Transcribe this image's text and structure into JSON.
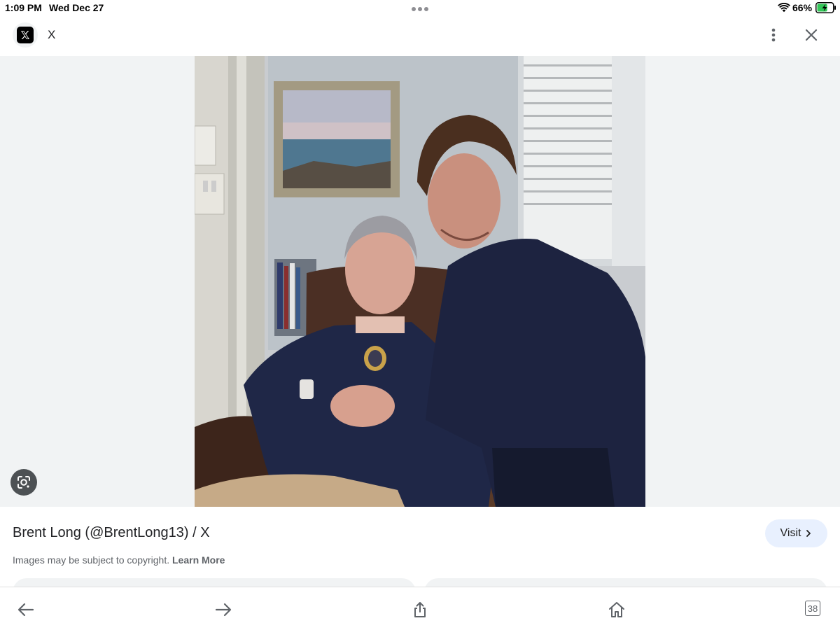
{
  "status_bar": {
    "time": "1:09 PM",
    "date": "Wed Dec 27",
    "battery_percent": "66%",
    "battery_level": 0.66,
    "charging": true,
    "icons": [
      "wifi-icon",
      "battery-icon",
      "multitask-dots-icon"
    ]
  },
  "top_bar": {
    "site_name": "X",
    "logo": "x-logo-icon",
    "icons": [
      "more-vert-icon",
      "close-icon"
    ]
  },
  "image_viewer": {
    "photo_alt": "Two men shaking hands in a room with a framed seascape painting",
    "lens_icon": "google-lens-icon"
  },
  "result": {
    "title": "Brent Long (@BrentLong13) / X",
    "visit_label": "Visit",
    "copyright_text": "Images may be subject to copyright.",
    "learn_more": "Learn More"
  },
  "bottom_bar": {
    "icons": [
      "back-arrow-icon",
      "forward-arrow-icon",
      "share-icon",
      "home-icon",
      "tabs-icon"
    ],
    "tab_count": "38"
  },
  "colors": {
    "background": "#ffffff",
    "image_backdrop": "#f1f3f4",
    "visit_button_bg": "#e8f0fe",
    "text_primary": "#202124",
    "text_secondary": "#5f6368"
  }
}
